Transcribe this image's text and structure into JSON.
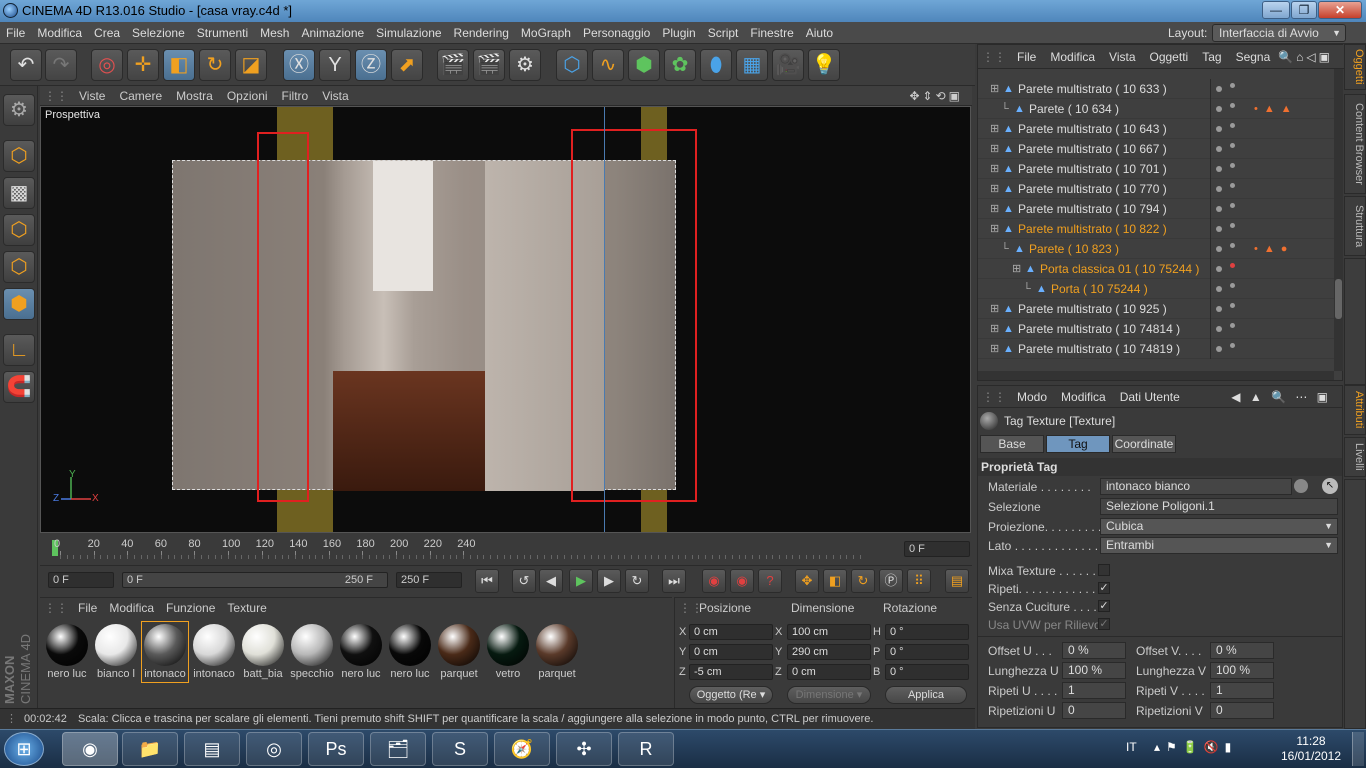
{
  "window": {
    "title": "CINEMA 4D R13.016 Studio - [casa vray.c4d *]",
    "minimize": "—",
    "maximize": "❐",
    "close": "✕"
  },
  "menubar": {
    "items": [
      "File",
      "Modifica",
      "Crea",
      "Selezione",
      "Strumenti",
      "Mesh",
      "Animazione",
      "Simulazione",
      "Rendering",
      "MoGraph",
      "Personaggio",
      "Plugin",
      "Script",
      "Finestre",
      "Aiuto"
    ],
    "layout_label": "Layout:",
    "layout_value": "Interfaccia di Avvio"
  },
  "viewport": {
    "menu": [
      "Viste",
      "Camere",
      "Mostra",
      "Opzioni",
      "Filtro",
      "Vista"
    ],
    "label": "Prospettiva",
    "axis_x": "X",
    "axis_y": "Y",
    "axis_z": "Z"
  },
  "timeline": {
    "ticks": [
      "0",
      "20",
      "40",
      "60",
      "80",
      "100",
      "120",
      "140",
      "160",
      "180",
      "200",
      "220",
      "240"
    ],
    "current_frame": "0 F",
    "start": "0 F",
    "range_start": "0 F",
    "range_end": "250 F",
    "end": "250 F"
  },
  "materials": {
    "menu": [
      "File",
      "Modifica",
      "Funzione",
      "Texture"
    ],
    "items": [
      {
        "name": "nero luc",
        "color": "#0a0a0a"
      },
      {
        "name": "bianco l",
        "color": "#e8e8e8"
      },
      {
        "name": "intonaco",
        "color": "#5a5a5a"
      },
      {
        "name": "intonaco",
        "color": "#d8d8d8"
      },
      {
        "name": "batt_bia",
        "color": "#e0e0d8"
      },
      {
        "name": "specchio",
        "color": "#b8b8b8"
      },
      {
        "name": "nero luc",
        "color": "#101010"
      },
      {
        "name": "nero luc",
        "color": "#080808"
      },
      {
        "name": "parquet",
        "color": "#4a2a18"
      },
      {
        "name": "vetro",
        "color": "#061a10"
      },
      {
        "name": "parquet",
        "color": "#5a3a2a"
      }
    ],
    "brand_top": "MAXON",
    "brand_bottom": "CINEMA 4D"
  },
  "coordinates": {
    "head_pos": "Posizione",
    "head_dim": "Dimensione",
    "head_rot": "Rotazione",
    "rows": [
      {
        "pl": "X",
        "pv": "0 cm",
        "dl": "X",
        "dv": "100 cm",
        "rl": "H",
        "rv": "0 °"
      },
      {
        "pl": "Y",
        "pv": "0 cm",
        "dl": "Y",
        "dv": "290 cm",
        "rl": "P",
        "rv": "0 °"
      },
      {
        "pl": "Z",
        "pv": "-5 cm",
        "dl": "Z",
        "dv": "0 cm",
        "rl": "B",
        "rv": "0 °"
      }
    ],
    "mode": "Oggetto (Re",
    "dim_mode": "Dimensione",
    "apply": "Applica"
  },
  "status": {
    "time": "00:02:42",
    "text": "Scala: Clicca e trascina per scalare gli elementi. Tieni premuto shift SHIFT per quantificare la scala / aggiungere alla selezione in modo punto, CTRL per rimuovere."
  },
  "objects": {
    "menu": [
      "File",
      "Modifica",
      "Vista",
      "Oggetti",
      "Tag",
      "Segna"
    ],
    "rows": [
      {
        "name": "Parete multistrato ( 10 633 )",
        "indent": 0,
        "hl": false
      },
      {
        "name": "Parete ( 10 634 )",
        "indent": 1,
        "hl": false
      },
      {
        "name": "Parete multistrato ( 10 643 )",
        "indent": 0,
        "hl": false
      },
      {
        "name": "Parete multistrato ( 10 667 )",
        "indent": 0,
        "hl": false
      },
      {
        "name": "Parete multistrato ( 10 701 )",
        "indent": 0,
        "hl": false
      },
      {
        "name": "Parete multistrato ( 10 770 )",
        "indent": 0,
        "hl": false
      },
      {
        "name": "Parete multistrato ( 10 794 )",
        "indent": 0,
        "hl": false
      },
      {
        "name": "Parete multistrato ( 10 822 )",
        "indent": 0,
        "hl": true
      },
      {
        "name": "Parete ( 10 823 )",
        "indent": 1,
        "hl": true
      },
      {
        "name": "Porta classica 01 ( 10 75244 )",
        "indent": 2,
        "hl": true
      },
      {
        "name": "Porta ( 10 75244 )",
        "indent": 3,
        "hl": true
      },
      {
        "name": "Parete multistrato ( 10 925 )",
        "indent": 0,
        "hl": false
      },
      {
        "name": "Parete multistrato ( 10 74814 )",
        "indent": 0,
        "hl": false
      },
      {
        "name": "Parete multistrato ( 10 74819 )",
        "indent": 0,
        "hl": false
      }
    ],
    "side_tabs": [
      "Oggetti",
      "Content Browser",
      "Struttura"
    ]
  },
  "attributes": {
    "menu": [
      "Modo",
      "Modifica",
      "Dati Utente"
    ],
    "header": "Tag Texture [Texture]",
    "tabs": [
      "Base",
      "Tag",
      "Coordinate"
    ],
    "section": "Proprietà Tag",
    "material_label": "Materiale . . . . . . . .",
    "material_value": "intonaco bianco",
    "selection_label": "Selezione",
    "selection_value": "Selezione Poligoni.1",
    "projection_label": "Proiezione. . . . . . . . .",
    "projection_value": "Cubica",
    "side_label": "Lato . . . . . . . . . . . . . .",
    "side_value": "Entrambi",
    "mix_label": "Mixa Texture . . . . . . .",
    "repeat_label": "Ripeti. . . . . . . . . . . . .",
    "seamless_label": "Senza Cuciture . . . . .",
    "uvw_label": "Usa UVW per Rilievo",
    "checkmark": "✓",
    "offset_u_label": "Offset U . . .",
    "offset_u_value": "0 %",
    "offset_v_label": "Offset V. . . .",
    "offset_v_value": "0 %",
    "length_u_label": "Lunghezza U",
    "length_u_value": "100 %",
    "length_v_label": "Lunghezza V",
    "length_v_value": "100 %",
    "repeat_u_label": "Ripeti U . . . .",
    "repeat_u_value": "1",
    "repeat_v_label": "Ripeti V . . . .",
    "repeat_v_value": "1",
    "repetitions_u_label": "Ripetizioni U",
    "repetitions_u_value": "0",
    "repetitions_v_label": "Ripetizioni V",
    "repetitions_v_value": "0",
    "side_tabs": [
      "Attributi",
      "Livelli"
    ]
  },
  "taskbar": {
    "lang": "IT",
    "time": "11:28",
    "date": "16/01/2012"
  }
}
